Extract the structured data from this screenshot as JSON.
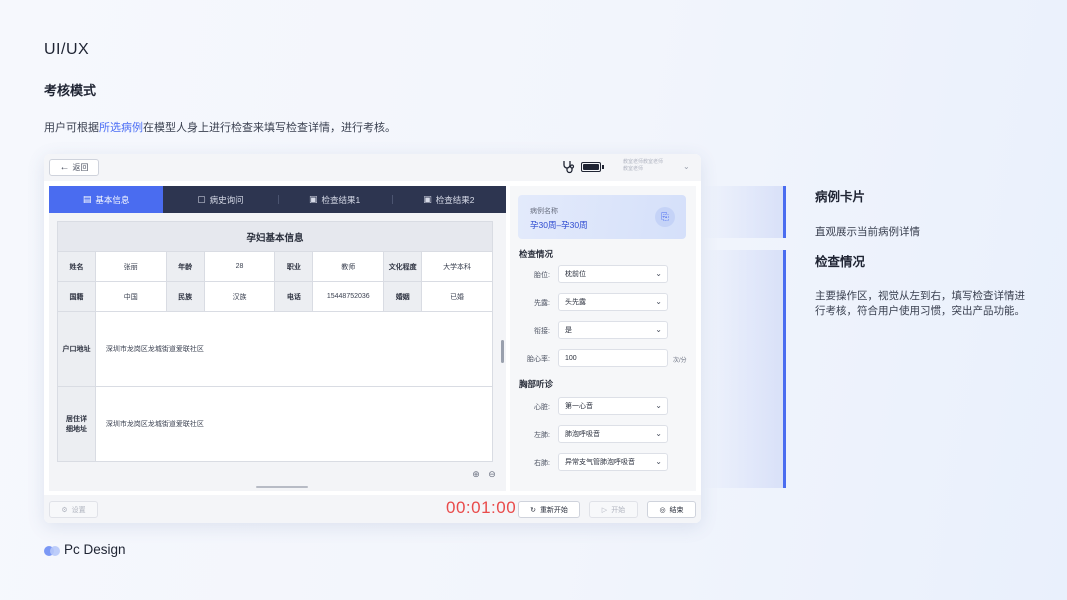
{
  "page": {
    "title": "UI/UX",
    "section_title": "考核模式",
    "desc_prefix": "用户可根据",
    "desc_highlight": "所选病例",
    "desc_suffix": "在模型人身上进行检查来填写检查详情，进行考核。",
    "footer": "Pc Design"
  },
  "topbar": {
    "back_label": "返回",
    "user_line1": "教室老师教室老师",
    "user_line2": "教室老师"
  },
  "tabs": [
    {
      "label": "基本信息",
      "icon": "id-card-icon"
    },
    {
      "label": "病史询问",
      "icon": "chat-icon"
    },
    {
      "label": "检查结果1",
      "icon": "report-icon"
    },
    {
      "label": "检查结果2",
      "icon": "report-icon"
    }
  ],
  "info_table": {
    "caption": "孕妇基本信息",
    "row1": [
      {
        "label": "姓名",
        "value": "张丽"
      },
      {
        "label": "年龄",
        "value": "28"
      },
      {
        "label": "职业",
        "value": "教师"
      },
      {
        "label": "文化程度",
        "value": "大学本科"
      }
    ],
    "row2": [
      {
        "label": "国籍",
        "value": "中国"
      },
      {
        "label": "民族",
        "value": "汉族"
      },
      {
        "label": "电话",
        "value": "15448752036"
      },
      {
        "label": "婚姻",
        "value": "已婚"
      }
    ],
    "address": {
      "label": "户口地址",
      "value": "深圳市龙岗区龙城街道爱联社区"
    },
    "residence": {
      "label1": "居住详",
      "label2": "细地址",
      "value": "深圳市龙岗区龙城街道爱联社区"
    }
  },
  "side_panel": {
    "case_card": {
      "label": "病例名称",
      "value": "孕30周–孕30周"
    },
    "exam_heading": "检查情况",
    "exam_rows": [
      {
        "label": "胎位:",
        "value": "枕前位"
      },
      {
        "label": "先露:",
        "value": "头先露"
      },
      {
        "label": "衔接:",
        "value": "是"
      },
      {
        "label": "胎心率:",
        "value": "100",
        "unit": "次/分"
      }
    ],
    "chest_heading": "胸部听诊",
    "chest_rows": [
      {
        "label": "心脏:",
        "value": "第一心音"
      },
      {
        "label": "左肺:",
        "value": "肺泡呼吸音"
      },
      {
        "label": "右肺:",
        "value": "异常支气管肺泡呼吸音"
      }
    ]
  },
  "bottombar": {
    "settings_label": "设置",
    "timer": "00:01:00",
    "restart_label": "重新开始",
    "start_label": "开始",
    "end_label": "结束"
  },
  "annotations": {
    "card_title": "病例卡片",
    "card_desc": "直观展示当前病例详情",
    "exam_title": "检查情况",
    "exam_desc": "主要操作区，视觉从左到右，填写检查详情进行考核，符合用户使用习惯，突出产品功能。"
  },
  "colors": {
    "accent": "#4a6cf0",
    "tab_bar": "#2d3550",
    "timer": "#e94b4b"
  }
}
